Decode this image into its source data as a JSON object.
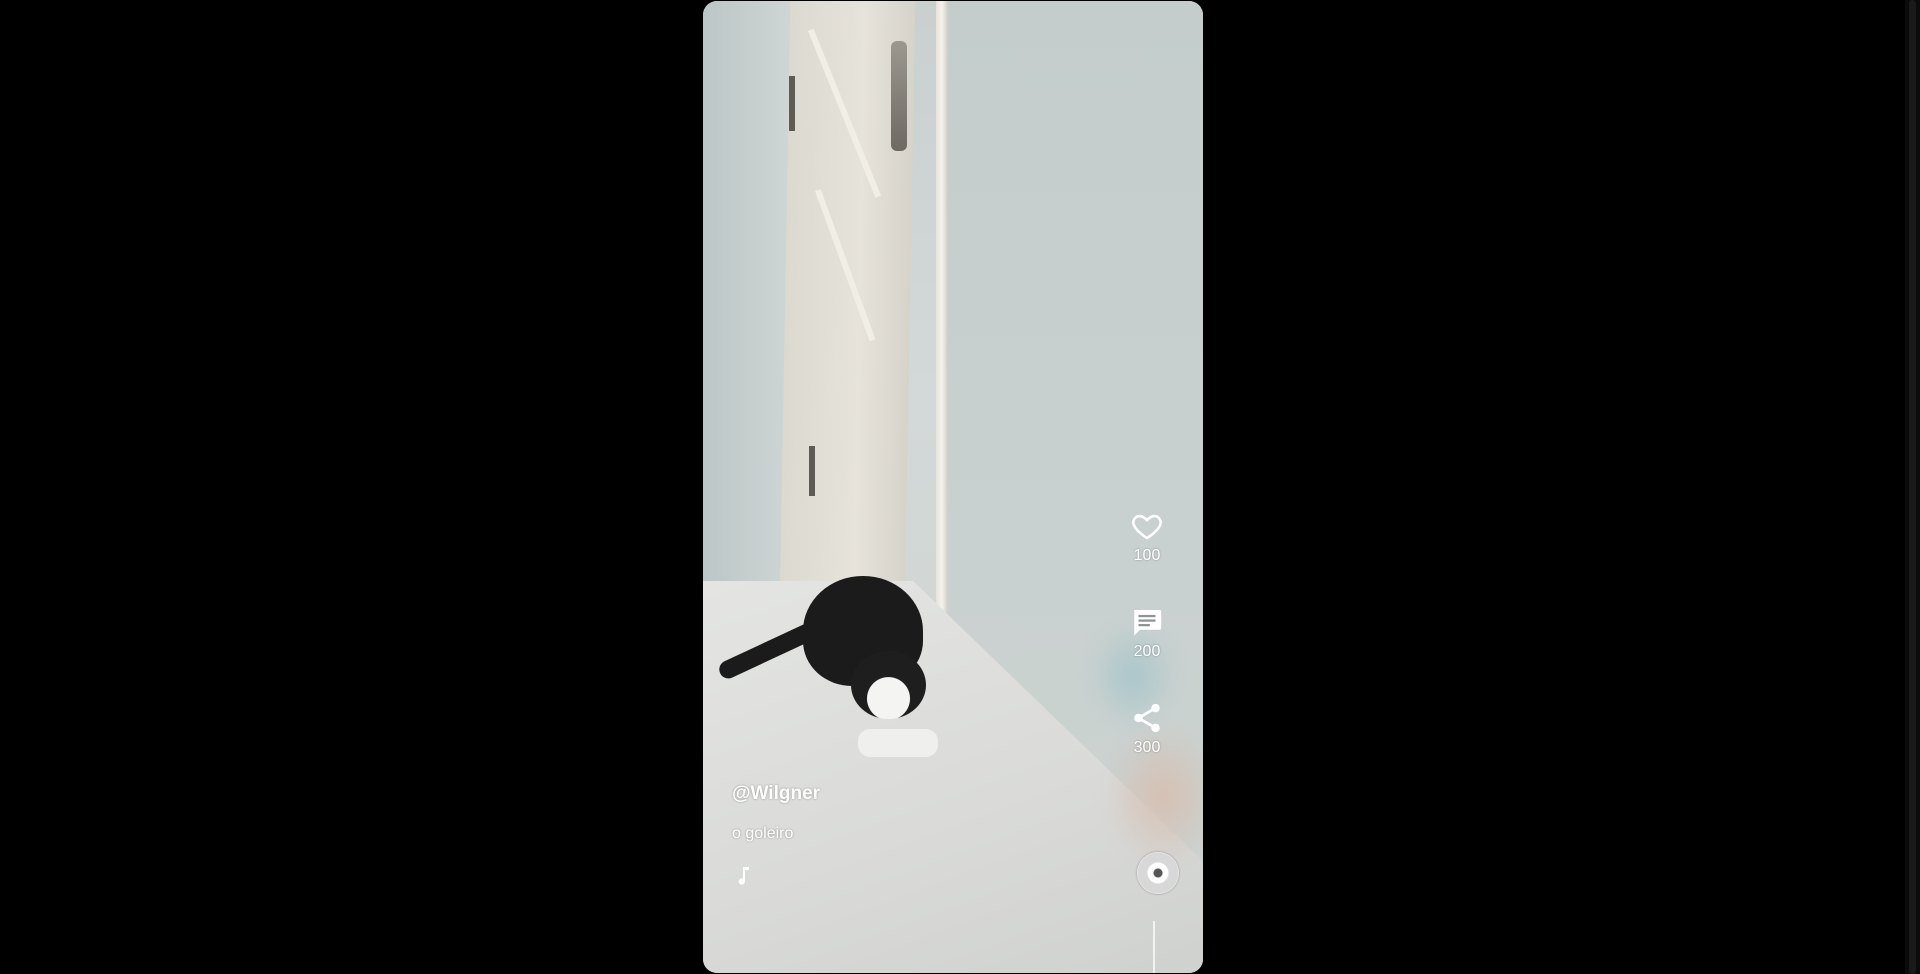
{
  "video": {
    "username": "@Wilgner",
    "description": "o goleiro",
    "music_title": ""
  },
  "actions": {
    "likes": {
      "icon": "heart-icon",
      "count": "100"
    },
    "comments": {
      "icon": "comment-icon",
      "count": "200"
    },
    "shares": {
      "icon": "share-icon",
      "count": "300"
    }
  },
  "icons": {
    "music": "music-note-icon",
    "disc": "music-disc-icon"
  },
  "colors": {
    "background": "#000000",
    "overlay_text": "#ffffff"
  }
}
